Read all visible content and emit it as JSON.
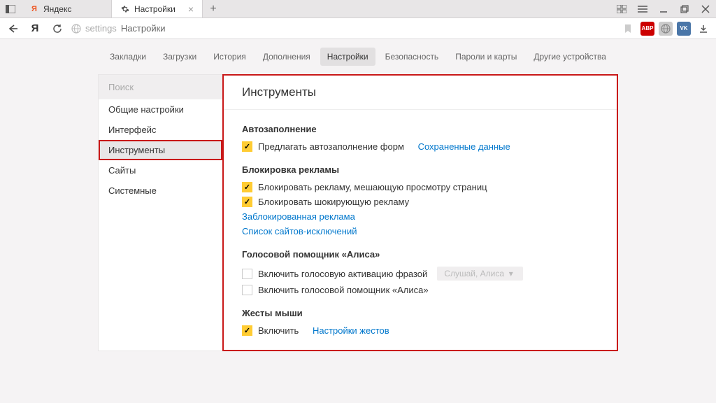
{
  "titlebar": {
    "tabs": [
      {
        "label": "Яндекс",
        "active": false
      },
      {
        "label": "Настройки",
        "active": true
      }
    ]
  },
  "urlbar": {
    "address_prefix": "settings",
    "address_rest": "Настройки"
  },
  "nav": {
    "items": [
      "Закладки",
      "Загрузки",
      "История",
      "Дополнения",
      "Настройки",
      "Безопасность",
      "Пароли и карты",
      "Другие устройства"
    ],
    "active": 4
  },
  "sidebar": {
    "search_placeholder": "Поиск",
    "items": [
      "Общие настройки",
      "Интерфейс",
      "Инструменты",
      "Сайты",
      "Системные"
    ],
    "selected": 2
  },
  "content": {
    "title": "Инструменты",
    "autofill": {
      "heading": "Автозаполнение",
      "opt1": "Предлагать автозаполнение форм",
      "link": "Сохраненные данные"
    },
    "adblock": {
      "heading": "Блокировка рекламы",
      "opt1": "Блокировать рекламу, мешающую просмотру страниц",
      "opt2": "Блокировать шокирующую рекламу",
      "link1": "Заблокированная реклама",
      "link2": "Список сайтов-исключений"
    },
    "alice": {
      "heading": "Голосовой помощник «Алиса»",
      "opt1": "Включить голосовую активацию фразой",
      "pill": "Слушай, Алиса",
      "opt2": "Включить голосовой помощник «Алиса»"
    },
    "mouse": {
      "heading": "Жесты мыши",
      "opt1": "Включить",
      "link": "Настройки жестов"
    }
  }
}
